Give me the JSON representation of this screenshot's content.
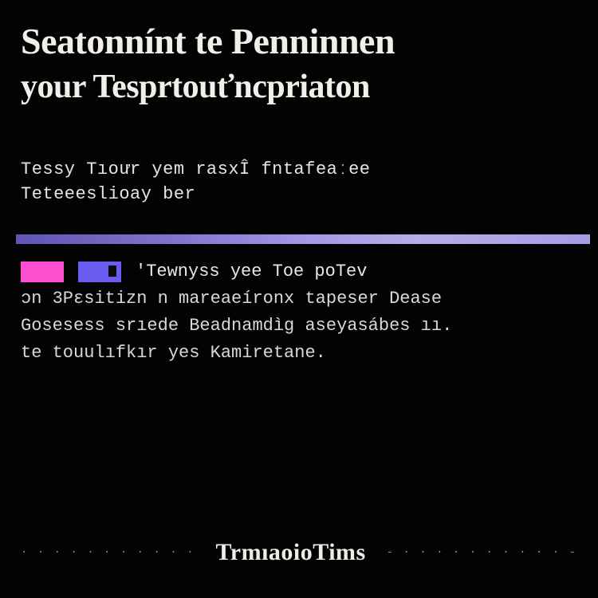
{
  "heading": {
    "line1": "Seatonnínt te Penninnen",
    "line2": "your Tesprtouťncpriaton"
  },
  "subhead": {
    "line1": "Tessy  Tıoưr  yem   rasxÎ  fntafeaːee",
    "line2": "Teteeeslioay  ber"
  },
  "body": {
    "icons": {
      "pink": "block-pink",
      "purple": "block-purple"
    },
    "line1_text": "'Tewnyss  yee  Toe  poTev",
    "line2": "ɔn 3Pɛsitizn n  mareaeíronx  tapeser  Dease",
    "line3": "Gosesess srıede  Beadnamdìg  aseyasábes  ıı.",
    "line4": "te  touulıfkır  yes  Kamiretane."
  },
  "footer": {
    "left_dots": "· · · · · · · · · · ·",
    "title": "TrmıaoioTims",
    "right_dots": "- · · · · · · · · · · -"
  },
  "colors": {
    "bg": "#030303",
    "text": "#ece8e4",
    "accent_pink": "#ff4fd1",
    "accent_purple": "#6a5cf0",
    "divider_start": "#6a5ec7",
    "divider_end": "#b9adff"
  }
}
